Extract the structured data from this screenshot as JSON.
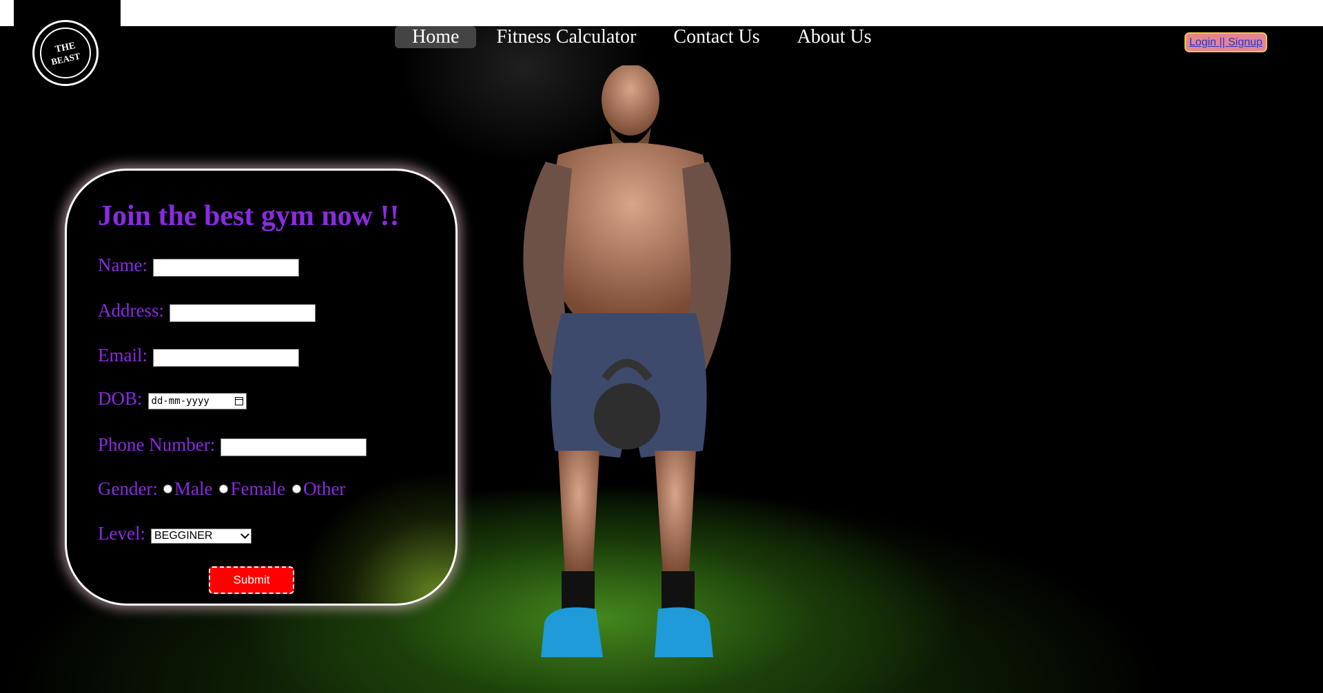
{
  "logo": {
    "line1": "THE",
    "line2": "BEAST",
    "icon": "gym-logo-icon"
  },
  "nav": {
    "items": [
      "Home",
      "Fitness Calculator",
      "Contact Us",
      "About Us"
    ],
    "active": "Home"
  },
  "auth": {
    "label": "Login || Signup"
  },
  "form": {
    "title": "Join the best gym now !!",
    "name_label": "Name:",
    "address_label": "Address:",
    "email_label": "Email:",
    "dob_label": "DOB:",
    "dob_placeholder": "dd-mm-yyyy",
    "phone_label": "Phone Number:",
    "gender_label": "Gender:",
    "gender_options": [
      "Male",
      "Female",
      "Other"
    ],
    "level_label": "Level:",
    "level_selected": "BEGGINER",
    "submit_label": "Submit"
  },
  "colors": {
    "accent": "#8a2be2",
    "submit": "#ff0000",
    "login_bg": "#e3858f",
    "login_border": "#f4c542"
  }
}
